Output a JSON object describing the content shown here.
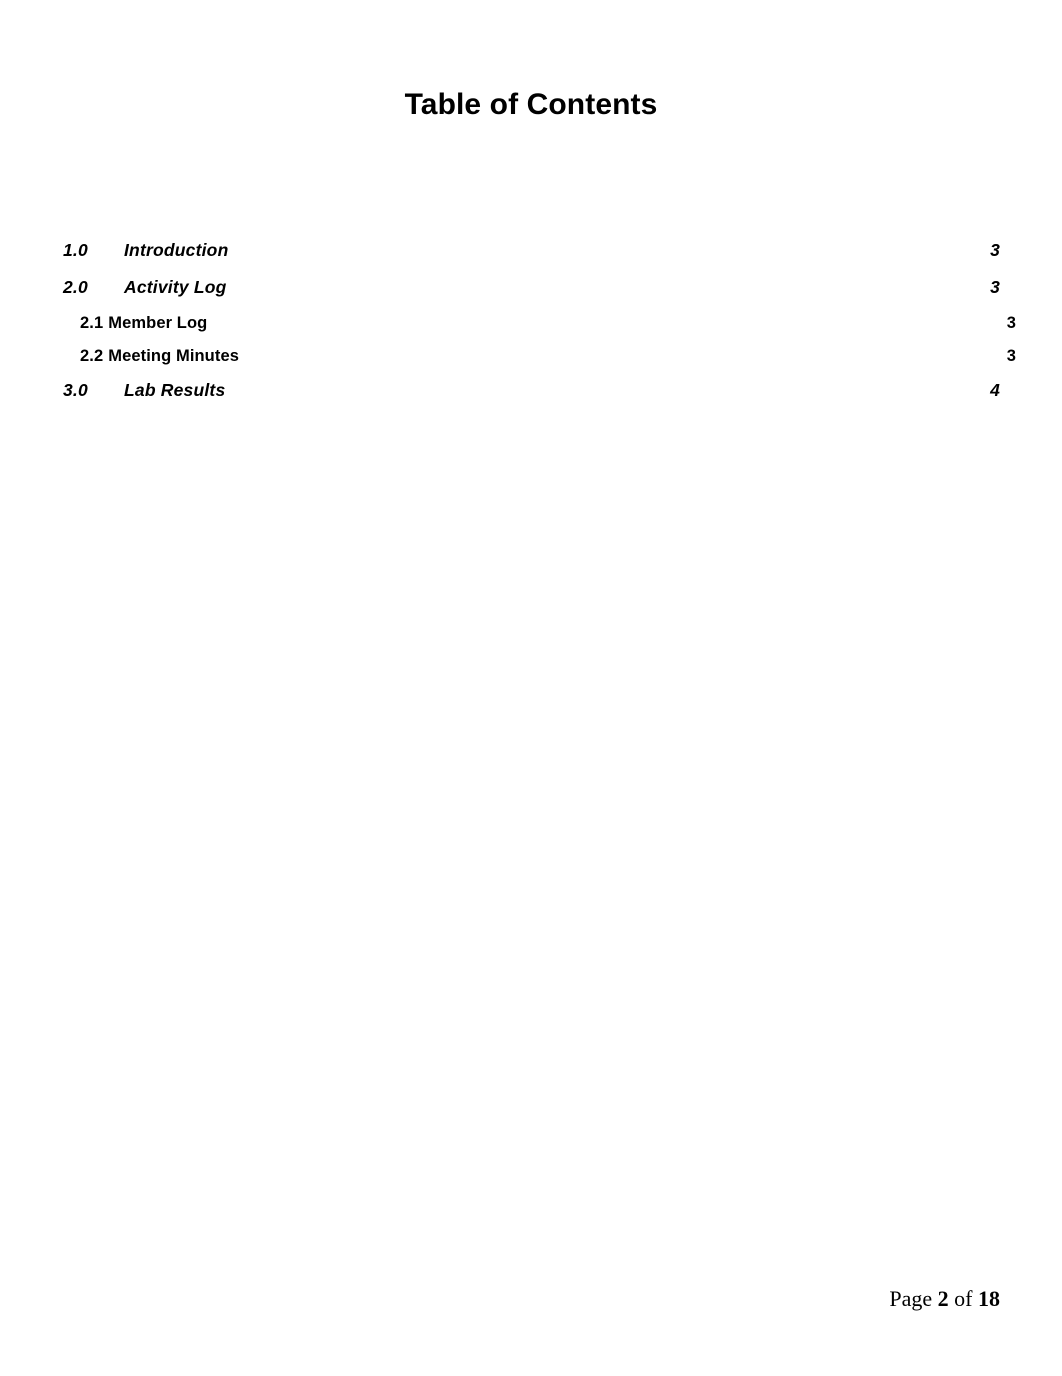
{
  "document": {
    "title": "Table of Contents",
    "background_color": "#ffffff",
    "text_color": "#000000"
  },
  "toc": {
    "entries": [
      {
        "number": "1.0",
        "title": "Introduction",
        "page": "3",
        "level": 1
      },
      {
        "number": "2.0",
        "title": "Activity Log",
        "page": "3",
        "level": 1
      },
      {
        "number": "2.1",
        "title": "Member Log",
        "page": "3",
        "level": 2
      },
      {
        "number": "2.2",
        "title": "Meeting Minutes",
        "page": "3",
        "level": 2
      },
      {
        "number": "3.0",
        "title": "Lab Results",
        "page": "4",
        "level": 1
      }
    ]
  },
  "footer": {
    "prefix": "Page",
    "current_page": "2",
    "separator": "of",
    "total_pages": "18"
  }
}
